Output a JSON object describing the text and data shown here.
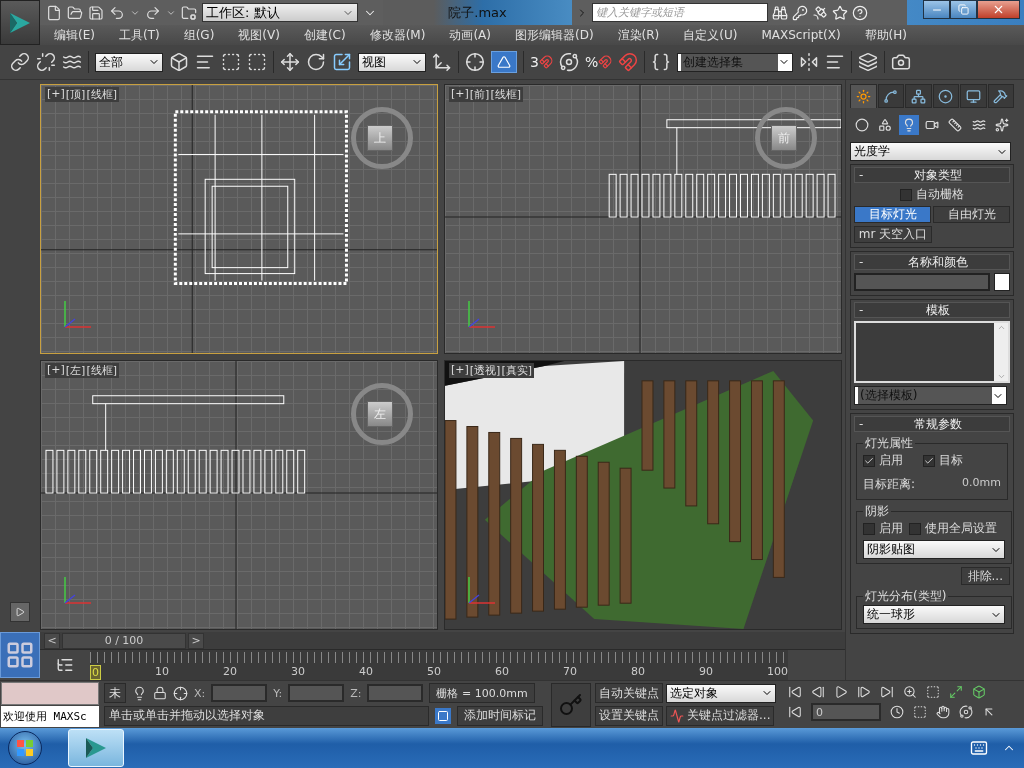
{
  "app": {
    "workspace": "工作区: 默认",
    "title": "院子.max",
    "search": {
      "placeholder": "键入关键字或短语"
    }
  },
  "menu": [
    "编辑(E)",
    "工具(T)",
    "组(G)",
    "视图(V)",
    "创建(C)",
    "修改器(M)",
    "动画(A)",
    "图形编辑器(D)",
    "渲染(R)",
    "自定义(U)",
    "MAXScript(X)",
    "帮助(H)"
  ],
  "toolbar": {
    "selection_filter": "全部",
    "reference_coordinate": "视图",
    "snap_label": "3",
    "percent_snap_label": "%",
    "named_selection": "创建选择集"
  },
  "viewports": [
    {
      "kind": "top",
      "labels": [
        "[+]",
        "[顶]",
        "[线框]"
      ],
      "cube": "上",
      "selected": true
    },
    {
      "kind": "front",
      "labels": [
        "[+]",
        "[前]",
        "[线框]"
      ],
      "cube": "前",
      "selected": false
    },
    {
      "kind": "left",
      "labels": [
        "[+]",
        "[左]",
        "[线框]"
      ],
      "cube": "左",
      "selected": false
    },
    {
      "kind": "perspective",
      "labels": [
        "[+]",
        "[透视]",
        "[真实]"
      ],
      "selected": false
    }
  ],
  "command_panel": {
    "tabs": [
      {
        "selected": true
      },
      {
        "selected": false
      },
      {
        "selected": false
      },
      {
        "selected": false
      },
      {
        "selected": false
      },
      {
        "selected": false
      }
    ],
    "categories": [
      {
        "selected": false
      },
      {
        "selected": false
      },
      {
        "selected": true
      },
      {
        "selected": false
      },
      {
        "selected": false
      },
      {
        "selected": false
      },
      {
        "selected": false
      }
    ],
    "category_dropdown": "光度学",
    "rollouts": [
      {
        "kind": "object_type",
        "toggle": "-",
        "title": "对象类型",
        "autogrid": {
          "label": "自动栅格",
          "checked": false
        },
        "buttons": [
          {
            "label": "目标灯光",
            "selected": true
          },
          {
            "label": "自由灯光",
            "selected": false
          },
          {
            "label": "mr 天空入口",
            "selected": false
          }
        ]
      },
      {
        "kind": "name_color",
        "toggle": "-",
        "title": "名称和颜色"
      },
      {
        "kind": "template",
        "toggle": "-",
        "title": "模板",
        "dropdown": "(选择模板)"
      },
      {
        "kind": "general",
        "toggle": "-",
        "title": "常规参数",
        "light_properties": {
          "title": "灯光属性",
          "enabled": {
            "label": "启用",
            "checked": true
          },
          "target": {
            "label": "目标",
            "checked": true
          },
          "distance_label": "目标距离:",
          "distance_value": "0.0mm"
        },
        "shadows": {
          "title": "阴影",
          "enabled": {
            "label": "启用",
            "checked": false
          },
          "global": {
            "label": "使用全局设置",
            "checked": false
          },
          "type": "阴影贴图",
          "exclude": "排除..."
        },
        "distribution": {
          "title": "灯光分布(类型)",
          "type": "统一球形"
        }
      }
    ]
  },
  "timeline": {
    "prev": "<",
    "frame_label": "0 / 100",
    "next": ">",
    "ticks": [
      "0",
      "10",
      "20",
      "30",
      "40",
      "50",
      "60",
      "70",
      "80",
      "90",
      "100"
    ]
  },
  "status": {
    "listener_output": "欢迎使用 MAXSc",
    "selection": "未",
    "x": "X:",
    "y": "Y:",
    "z": "Z:",
    "grid": "栅格 = 100.0mm",
    "prompt": "单击或单击并拖动以选择对象",
    "add_time_tag": "添加时间标记",
    "auto_key": "自动关键点",
    "set_key": "设置关键点",
    "key_mode": "选定对象",
    "key_filters": "关键点过滤器...",
    "frame": "0"
  }
}
